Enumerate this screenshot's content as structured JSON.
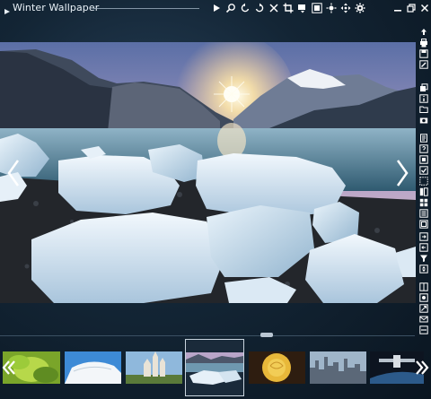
{
  "window": {
    "title": "Winter Wallpaper"
  },
  "toolbar": {
    "icons": [
      "play-icon",
      "zoom-icon",
      "rotate-left-icon",
      "rotate-right-icon",
      "close-image-icon",
      "crop-icon",
      "dropdown-arrow-icon",
      "fullscreen-icon",
      "brightness-icon",
      "move-icon",
      "settings-icon"
    ]
  },
  "window_controls": [
    "minimize-icon",
    "restore-icon",
    "close-icon"
  ],
  "sidebar": {
    "icons": [
      "upload-icon",
      "print-icon",
      "save-icon",
      "edit-icon",
      "copy-icon",
      "info-icon",
      "folder-icon",
      "camera-icon",
      "document-icon",
      "help-icon",
      "page-icon",
      "check-icon",
      "select-icon",
      "layout-icon",
      "grid-icon",
      "list-icon",
      "frame-icon",
      "export-icon",
      "import-icon",
      "filter-icon",
      "sort-icon",
      "compare-icon",
      "tag-icon",
      "share-icon",
      "mail-icon",
      "more-icon"
    ]
  },
  "filmstrip": {
    "thumbnails": [
      "leaves",
      "white-building",
      "castle",
      "winter-lake",
      "yellow-rose",
      "city-skyline",
      "space-station"
    ],
    "selected_index": 3
  },
  "colors": {
    "background": "#0b1622",
    "accent": "#c9d4de"
  }
}
